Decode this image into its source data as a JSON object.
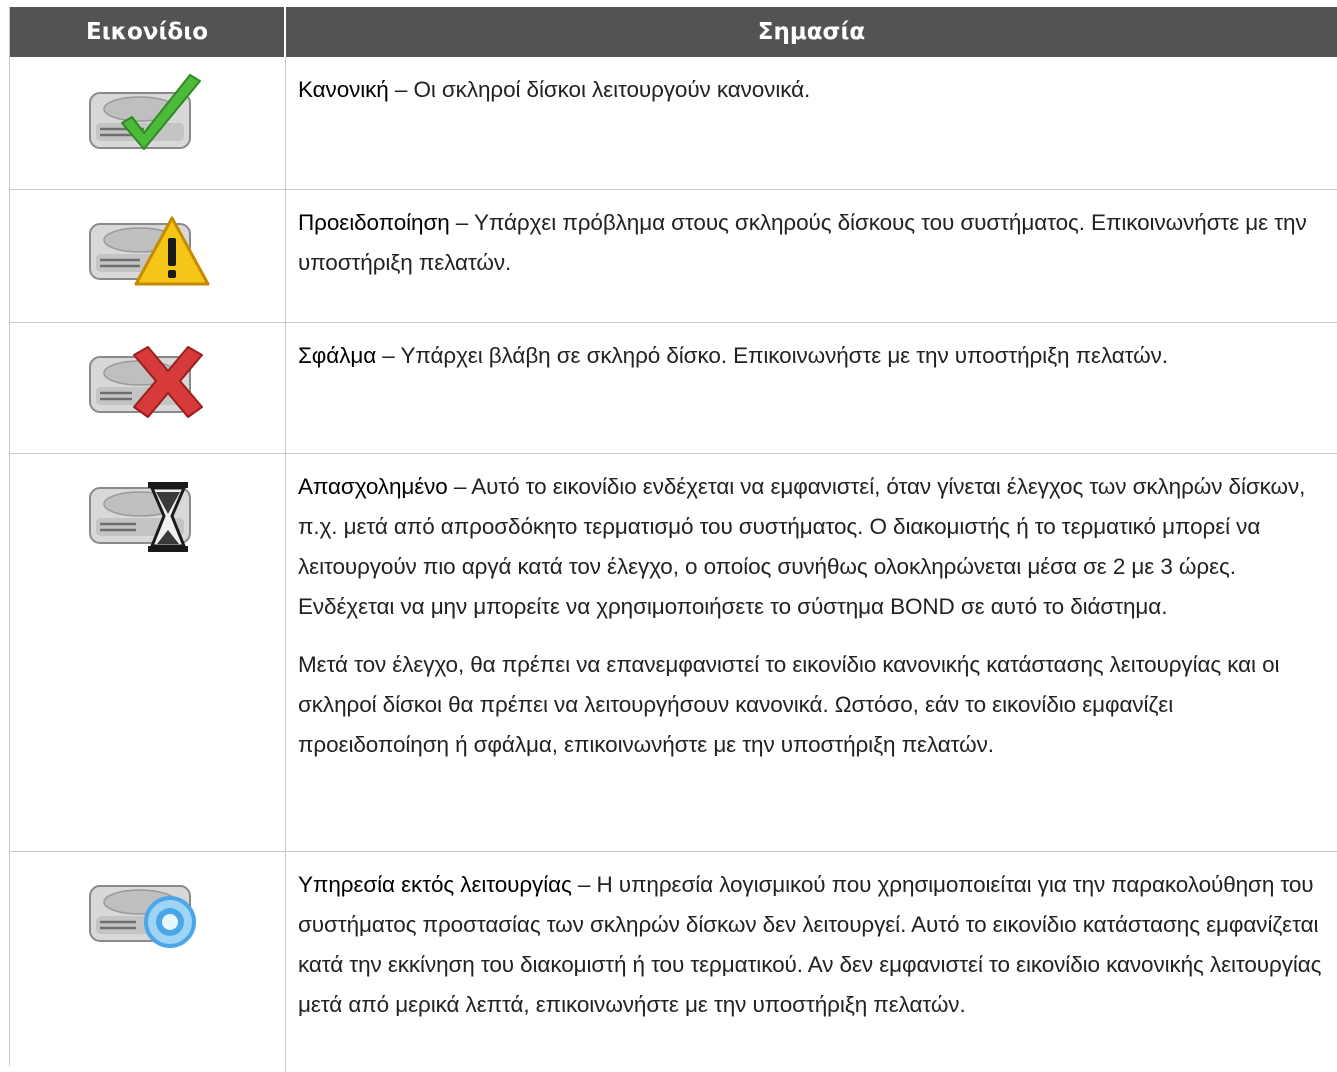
{
  "table": {
    "headers": {
      "icon": "Εικονίδιο",
      "meaning": "Σημασία"
    },
    "rows": [
      {
        "icon": "disk-ok-icon",
        "term": "Κανονική",
        "sep": " – ",
        "desc": "Οι σκληροί δίσκοι λειτουργούν κανονικά."
      },
      {
        "icon": "disk-warning-icon",
        "term": "Προειδοποίηση",
        "sep": " – ",
        "desc": "Υπάρχει πρόβλημα στους σκληρούς δίσκους του συστήματος. Επικοινωνήστε με την υποστήριξη πελατών."
      },
      {
        "icon": "disk-error-icon",
        "term": "Σφάλμα",
        "sep": " – ",
        "desc": "Υπάρχει βλάβη σε σκληρό δίσκο. Επικοινωνήστε με την υποστήριξη πελατών."
      },
      {
        "icon": "disk-busy-icon",
        "term": "Απασχολημένο",
        "sep": " – ",
        "desc": "Αυτό το εικονίδιο ενδέχεται να εμφανιστεί, όταν γίνεται έλεγχος των σκληρών δίσκων, π.χ. μετά από απροσδόκητο τερματισμό του συστήματος. Ο διακομιστής ή το τερματικό μπορεί να λειτουργούν πιο αργά κατά τον έλεγχο, ο οποίος συνήθως ολοκληρώνεται μέσα σε 2 με 3 ώρες. Ενδέχεται να μην μπορείτε να χρησιμοποιήσετε το σύστημα BOND σε αυτό το διάστημα.",
        "desc2": "Μετά τον έλεγχο, θα πρέπει να επανεμφανιστεί το εικονίδιο κανονικής κατάστασης λειτουργίας και οι σκληροί δίσκοι θα πρέπει να λειτουργήσουν κανονικά. Ωστόσο, εάν το εικονίδιο εμφανίζει προειδοποίηση ή σφάλμα, επικοινωνήστε με την υποστήριξη πελατών."
      },
      {
        "icon": "disk-service-off-icon",
        "term": "Υπηρεσία εκτός λειτουργίας",
        "sep": " – ",
        "desc": "Η υπηρεσία λογισμικού που χρησιμοποιείται για την παρακολούθηση του συστήματος προστασίας των σκληρών δίσκων δεν λειτουργεί. Αυτό το εικονίδιο κατάστασης εμφανίζεται κατά την εκκίνηση του διακομιστή ή του τερματικού. Αν δεν εμφανιστεί το εικονίδιο κανονικής λειτουργίας μετά από μερικά λεπτά, επικοινωνήστε με την υποστήριξη πελατών."
      }
    ]
  },
  "colors": {
    "header_bg": "#535353",
    "check_green": "#4cbb3a",
    "warning_yellow": "#f5c518",
    "error_red": "#d63a3a",
    "service_blue": "#4aa6e8"
  }
}
